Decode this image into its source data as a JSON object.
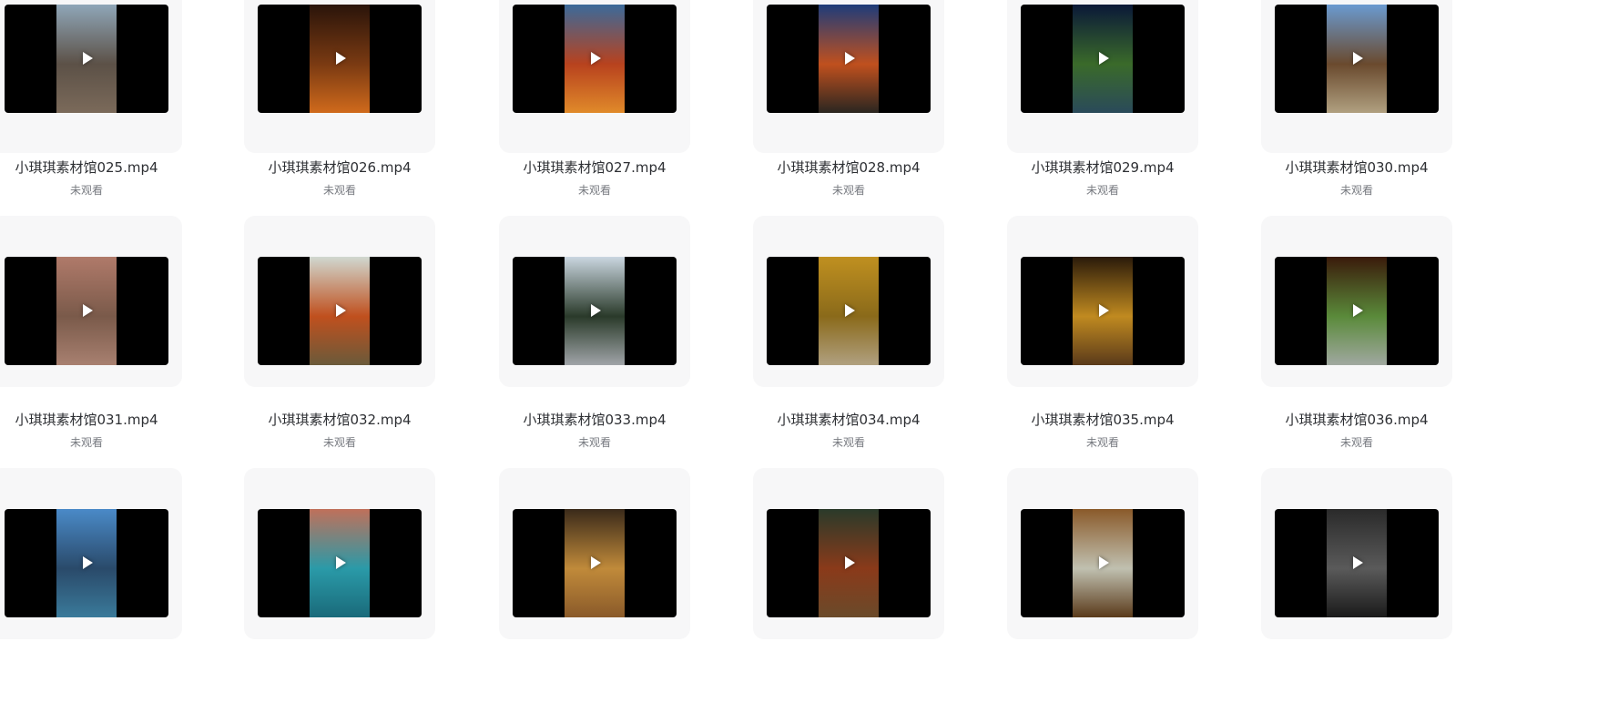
{
  "files": [
    {
      "name": "小琪琪素材馆025.mp4",
      "status": "未观看",
      "thumb_colors": [
        "#8fa6b8",
        "#5c5147",
        "#7b6a5a"
      ]
    },
    {
      "name": "小琪琪素材馆026.mp4",
      "status": "未观看",
      "thumb_colors": [
        "#2a140a",
        "#7a3a12",
        "#d06a1c"
      ]
    },
    {
      "name": "小琪琪素材馆027.mp4",
      "status": "未观看",
      "thumb_colors": [
        "#3b6a9a",
        "#b8421e",
        "#e08a2a"
      ]
    },
    {
      "name": "小琪琪素材馆028.mp4",
      "status": "未观看",
      "thumb_colors": [
        "#1e3c7a",
        "#c0501e",
        "#2a2620"
      ]
    },
    {
      "name": "小琪琪素材馆029.mp4",
      "status": "未观看",
      "thumb_colors": [
        "#0a1838",
        "#3a6a2a",
        "#2a4a5a"
      ]
    },
    {
      "name": "小琪琪素材馆030.mp4",
      "status": "未观看",
      "thumb_colors": [
        "#6a9ad0",
        "#6a4a2e",
        "#b0a080"
      ]
    },
    {
      "name": "小琪琪素材馆031.mp4",
      "status": "未观看",
      "thumb_colors": [
        "#b07a6a",
        "#7a5a4a",
        "#a88070"
      ]
    },
    {
      "name": "小琪琪素材馆032.mp4",
      "status": "未观看",
      "thumb_colors": [
        "#d0d8d0",
        "#c0501e",
        "#6a5a3a"
      ]
    },
    {
      "name": "小琪琪素材馆033.mp4",
      "status": "未观看",
      "thumb_colors": [
        "#cad6e0",
        "#2a3a2a",
        "#a0a4a8"
      ]
    },
    {
      "name": "小琪琪素材馆034.mp4",
      "status": "未观看",
      "thumb_colors": [
        "#c09020",
        "#8a6a1a",
        "#b0a080"
      ]
    },
    {
      "name": "小琪琪素材馆035.mp4",
      "status": "未观看",
      "thumb_colors": [
        "#2a1a0a",
        "#c08a20",
        "#5a3a1a"
      ]
    },
    {
      "name": "小琪琪素材馆036.mp4",
      "status": "未观看",
      "thumb_colors": [
        "#3a1a0a",
        "#5a8a3a",
        "#a0a8a0"
      ]
    },
    {
      "name": "",
      "status": "",
      "thumb_colors": [
        "#4a8ac8",
        "#2a4a6a",
        "#3a7a9a"
      ]
    },
    {
      "name": "",
      "status": "",
      "thumb_colors": [
        "#c0705a",
        "#2a9aa8",
        "#1a6a7a"
      ]
    },
    {
      "name": "",
      "status": "",
      "thumb_colors": [
        "#3a2a1a",
        "#c08a3a",
        "#8a5a2a"
      ]
    },
    {
      "name": "",
      "status": "",
      "thumb_colors": [
        "#2a3a2a",
        "#8a3a1a",
        "#6a4a2a"
      ]
    },
    {
      "name": "",
      "status": "",
      "thumb_colors": [
        "#8a5a2a",
        "#c0c0b0",
        "#5a3a1a"
      ]
    },
    {
      "name": "",
      "status": "",
      "thumb_colors": [
        "#2a2a2a",
        "#5a5a5a",
        "#1a1a1a"
      ]
    }
  ],
  "play_icon": "play-icon"
}
